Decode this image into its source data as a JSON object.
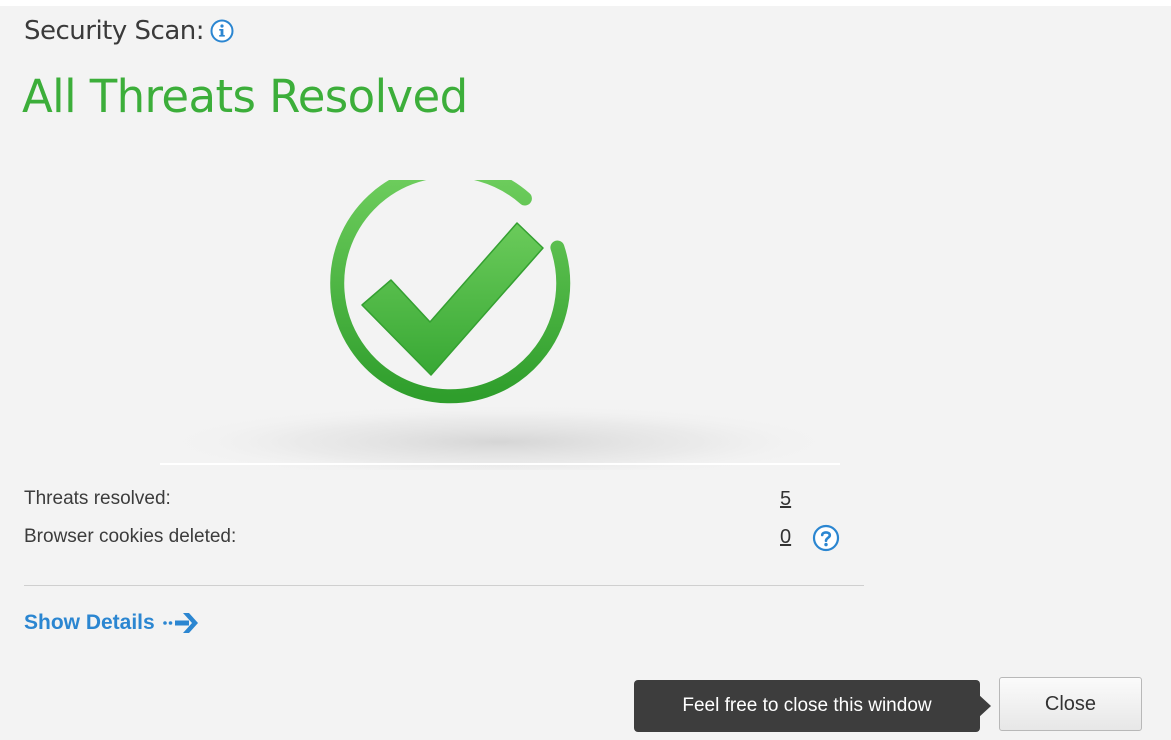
{
  "header": {
    "label": "Security Scan:",
    "info_icon": "info-icon"
  },
  "status": {
    "title": "All Threats Resolved",
    "icon": "checkmark-circle-icon",
    "color": "#3cae3a"
  },
  "stats": [
    {
      "label": "Threats resolved:",
      "value": "5"
    },
    {
      "label": "Browser cookies deleted:",
      "value": "0",
      "help_icon": "question-icon"
    }
  ],
  "details_link": {
    "label": "Show Details",
    "icon": "arrow-right-icon",
    "color": "#2b86d1"
  },
  "footer": {
    "tooltip": "Feel free to close this window",
    "close_label": "Close"
  }
}
